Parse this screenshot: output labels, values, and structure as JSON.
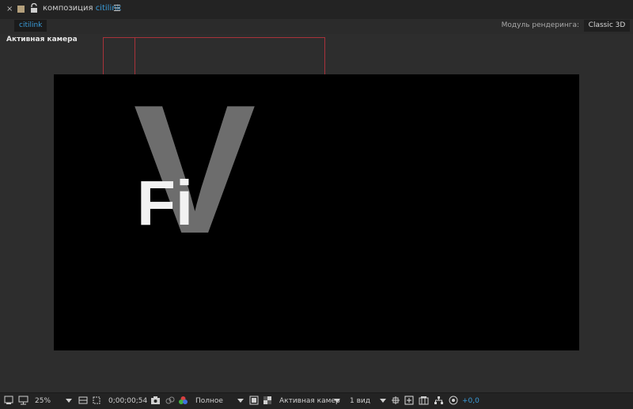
{
  "panel": {
    "close_glyph": "×",
    "title_prefix": "композиция",
    "title_comp": "citilink",
    "menu_glyph": "☰",
    "icons": [
      "close-icon",
      "color-swatch-icon",
      "unlock-icon",
      "panel-menu-icon"
    ]
  },
  "subbar": {
    "active_tab": "citilink",
    "renderer_label": "Модуль рендеринга:",
    "renderer_value": "Classic 3D"
  },
  "viewer": {
    "view_label": "Активная камера",
    "canvas_text": {
      "large_letter": "V",
      "small_text": "Fi"
    },
    "colors": {
      "canvas_bg": "#000000",
      "large_letter": "#6d6d6d",
      "small_text": "#f2f2f2",
      "guide": "#a8323a"
    }
  },
  "toolbar": {
    "zoom": "25%",
    "timecode": "0;00;00;54",
    "resolution": "Полное",
    "camera": "Активная камер",
    "views": "1 вид",
    "exposure": "+0,0",
    "icons": [
      "always-preview-icon",
      "monitor-icon",
      "zoom-dropdown-icon",
      "safe-zones-icon",
      "region-of-interest-icon",
      "camera-snapshot-icon",
      "show-snapshot-icon",
      "color-channels-icon",
      "fast-preview-icon",
      "transparency-grid-icon",
      "3d-ground-icon",
      "toggle-mask-icon",
      "timeline-icon",
      "flowchart-icon",
      "exposure-reset-icon"
    ]
  }
}
